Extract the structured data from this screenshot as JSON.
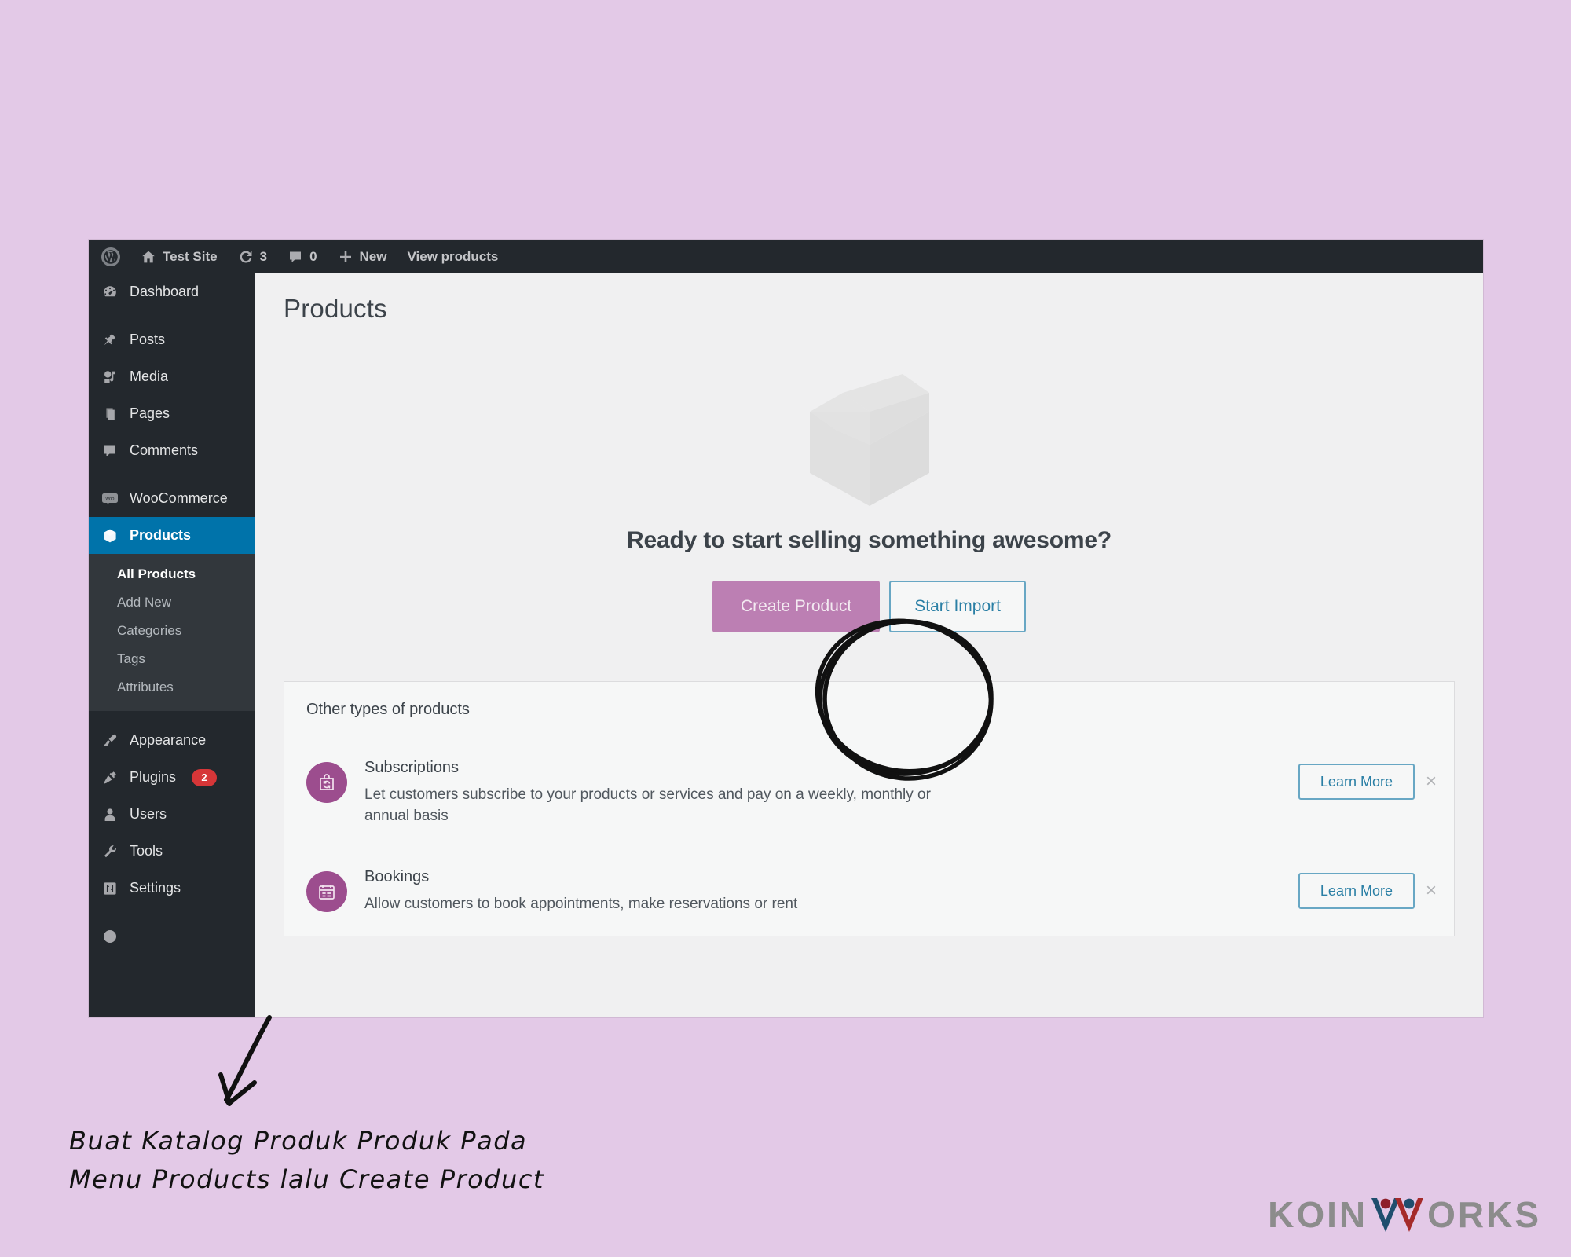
{
  "page": {
    "background_color": "#e3c9e7",
    "caption_line1": "Buat Katalog Produk Produk Pada",
    "caption_line2": "Menu Products lalu Create Product"
  },
  "adminbar": {
    "items": [
      {
        "icon": "wordpress-logo-icon",
        "label": ""
      },
      {
        "icon": "home-icon",
        "label": "Test Site"
      },
      {
        "icon": "refresh-icon",
        "label": "3"
      },
      {
        "icon": "comment-icon",
        "label": "0"
      },
      {
        "icon": "plus-icon",
        "label": "New"
      },
      {
        "icon": "",
        "label": "View products"
      }
    ]
  },
  "sidebar": {
    "items": [
      {
        "label": "Dashboard",
        "icon": "dashboard-icon",
        "current": false
      },
      {
        "label": "Posts",
        "icon": "pin-icon",
        "current": false
      },
      {
        "label": "Media",
        "icon": "media-icon",
        "current": false
      },
      {
        "label": "Pages",
        "icon": "pages-icon",
        "current": false
      },
      {
        "label": "Comments",
        "icon": "comment-icon",
        "current": false
      },
      {
        "label": "WooCommerce",
        "icon": "woo-icon",
        "current": false
      },
      {
        "label": "Products",
        "icon": "box-icon",
        "current": true
      },
      {
        "label": "Appearance",
        "icon": "brush-icon",
        "current": false
      },
      {
        "label": "Plugins",
        "icon": "plug-icon",
        "current": false,
        "badge": "2"
      },
      {
        "label": "Users",
        "icon": "user-icon",
        "current": false
      },
      {
        "label": "Tools",
        "icon": "wrench-icon",
        "current": false
      },
      {
        "label": "Settings",
        "icon": "settings-icon",
        "current": false
      }
    ],
    "submenu": [
      {
        "label": "All Products",
        "current": true
      },
      {
        "label": "Add New",
        "current": false
      },
      {
        "label": "Categories",
        "current": false
      },
      {
        "label": "Tags",
        "current": false
      },
      {
        "label": "Attributes",
        "current": false
      }
    ],
    "active_color": "#0073aa",
    "badge_color": "#d63638"
  },
  "main": {
    "page_title": "Products",
    "hero": {
      "illustration": "package-box-icon",
      "title": "Ready to start selling something awesome?",
      "primary_button": "Create Product",
      "secondary_button": "Start Import",
      "primary_color": "#bc7fb3",
      "secondary_color": "#2a7fa5"
    },
    "other_types": {
      "heading": "Other types of products",
      "rows": [
        {
          "icon": "subscription-bag-icon",
          "name": "Subscriptions",
          "description": "Let customers subscribe to your products or services and pay on a weekly, monthly or annual basis",
          "cta": "Learn More",
          "dismiss": "×"
        },
        {
          "icon": "calendar-icon",
          "name": "Bookings",
          "description": "Allow customers to book appointments, make reservations or rent",
          "cta": "Learn More",
          "dismiss": "×"
        }
      ]
    }
  },
  "logo": {
    "text_before": "KOIN",
    "text_after": "ORKS",
    "mark": "double-person-w-icon",
    "text_color": "#8c8c8c",
    "mark_color_left": "#1f4e6e",
    "mark_color_right": "#a52a2a"
  }
}
